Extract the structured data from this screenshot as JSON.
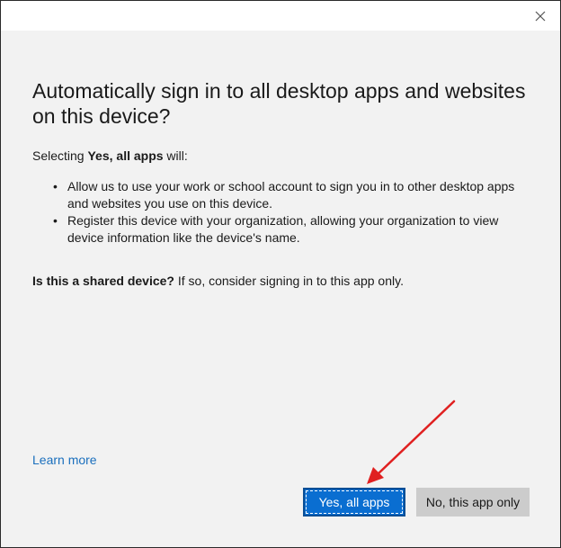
{
  "dialog": {
    "close_icon": "close-icon",
    "heading": "Automatically sign in to all desktop apps and websites on this device?",
    "intro": {
      "prefix": "Selecting ",
      "bold": "Yes, all apps",
      "suffix": " will:"
    },
    "bullets": [
      "Allow us to use your work or school account to sign you in to other desktop apps and websites you use on this device.",
      "Register this device with your organization, allowing your organization to view device information like the device's name."
    ],
    "shared": {
      "bold": "Is this a shared device?",
      "rest": " If so, consider signing in to this app only."
    },
    "learn_more": "Learn more",
    "buttons": {
      "yes_all_apps": "Yes, all apps",
      "no_this_app_only": "No, this app only"
    }
  },
  "colors": {
    "accent": "#0a6ed1",
    "link": "#1a6fbd",
    "annotation_arrow": "#e02020"
  }
}
